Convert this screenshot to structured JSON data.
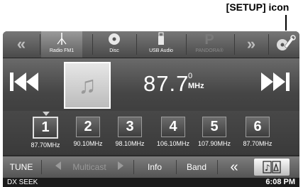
{
  "annotation": {
    "setup_label": "[SETUP] icon"
  },
  "source_bar": {
    "items": [
      {
        "label": "Radio FM1",
        "icon": "antenna-icon"
      },
      {
        "label": "Disc",
        "icon": "disc-icon"
      },
      {
        "label": "USB Audio",
        "icon": "usb-icon"
      },
      {
        "label": "PANDORA®",
        "icon": "pandora-icon"
      }
    ],
    "left_arrow": "«",
    "right_arrow": "»"
  },
  "now_playing": {
    "frequency": "87.7",
    "frequency_sub": "0",
    "unit": "MHz"
  },
  "presets": [
    {
      "number": "1",
      "frequency": "87.70MHz",
      "active": true
    },
    {
      "number": "2",
      "frequency": "90.10MHz"
    },
    {
      "number": "3",
      "frequency": "98.10MHz"
    },
    {
      "number": "4",
      "frequency": "106.10MHz"
    },
    {
      "number": "5",
      "frequency": "107.90MHz"
    },
    {
      "number": "6",
      "frequency": "87.70MHz"
    }
  ],
  "bottom_bar": {
    "tune": "TUNE",
    "multicast": "Multicast",
    "info": "Info",
    "band": "Band",
    "back_arrow": "«"
  },
  "status": {
    "mode": "DX SEEK",
    "time": "6:08 PM"
  }
}
